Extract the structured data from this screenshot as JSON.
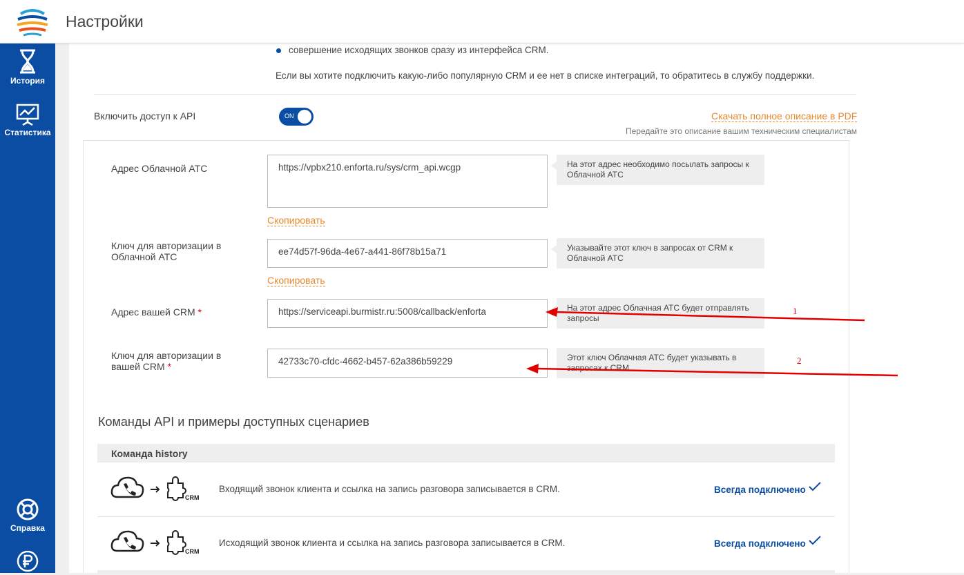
{
  "header": {
    "title": "Настройки"
  },
  "sidebar": {
    "items": [
      {
        "label": "История",
        "icon": "hourglass-icon"
      },
      {
        "label": "Статистика",
        "icon": "chart-board-icon"
      },
      {
        "label": "Справка",
        "icon": "lifebuoy-icon"
      },
      {
        "label": "",
        "icon": "ruble-icon"
      }
    ]
  },
  "intro": {
    "bullet": "совершение исходящих звонков сразу из интерфейса CRM.",
    "note": "Если вы хотите подключить какую-либо популярную CRM и ее нет в списке интеграций, то обратитесь в службу поддержки."
  },
  "api_toggle": {
    "label": "Включить доступ к API",
    "state": "ON",
    "download_link": "Скачать полное описание в PDF",
    "download_hint": "Передайте это описание вашим техническим специалистам"
  },
  "fields": {
    "pbx_address": {
      "label": "Адрес Облачной АТС",
      "value": "https://vpbx210.enforta.ru/sys/crm_api.wcgp",
      "hint": "На этот адрес необходимо посылать запросы к Облачной АТС",
      "copy": "Скопировать"
    },
    "pbx_key": {
      "label": "Ключ для авторизации в Облачной АТС",
      "value": "ee74d57f-96da-4e67-a441-86f78b15a71",
      "hint": "Указывайте этот ключ в запросах от CRM к Облачной АТС",
      "copy": "Скопировать"
    },
    "crm_address": {
      "label": "Адрес вашей CRM",
      "value": "https://serviceapi.burmistr.ru:5008/callback/enforta",
      "hint": "На этот адрес Облачная АТС будет отправлять запросы"
    },
    "crm_key": {
      "label": "Ключ для авторизации в вашей CRM",
      "value": "42733c70-cfdc-4662-b457-62a386b59229",
      "hint": "Этот ключ Облачная АТС будет указывать в запросах к CRM"
    }
  },
  "annotations": {
    "first": "1",
    "second": "2",
    "arrow_color": "#e00000"
  },
  "commands": {
    "title": "Команды API и примеры доступных сценариев",
    "group": "Команда history",
    "rows": [
      {
        "text": "Входящий звонок клиента и ссылка на запись разговора записывается в CRM.",
        "status": "Всегда подключено",
        "badge": "CRM"
      },
      {
        "text": "Исходящий звонок клиента и ссылка на запись разговора записывается в CRM.",
        "status": "Всегда подключено",
        "badge": "CRM"
      }
    ]
  },
  "colors": {
    "brand_blue": "#0a4da2",
    "accent_orange": "#e8892b",
    "required_red": "#d0021b"
  }
}
